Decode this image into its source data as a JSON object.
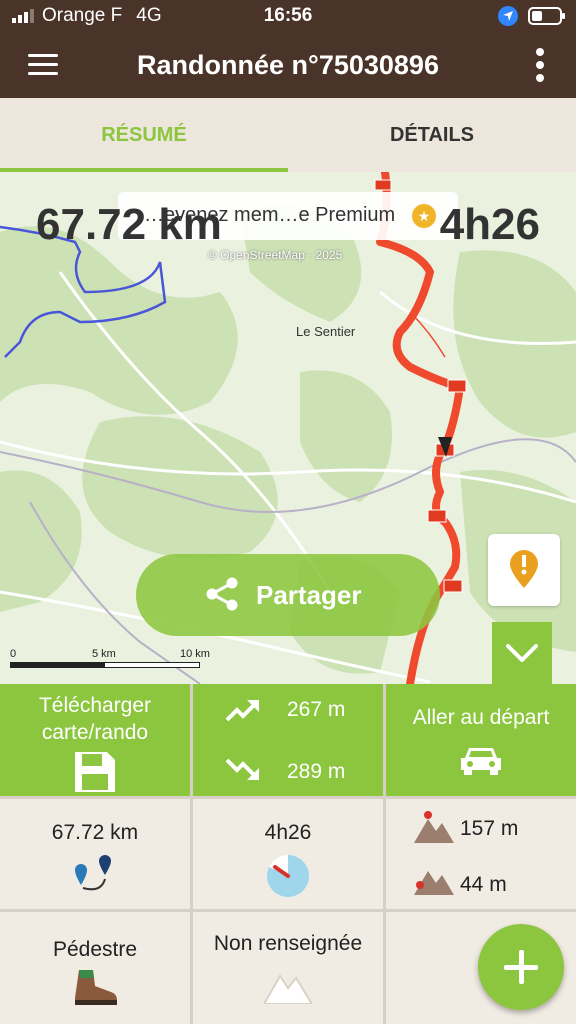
{
  "status_bar": {
    "carrier": "Orange F",
    "network": "4G",
    "time": "16:56"
  },
  "header": {
    "title": "Randonnée n°75030896",
    "menu_icon": "hamburger-icon",
    "more_icon": "more-vertical-icon"
  },
  "tabs": [
    {
      "label": "RÉSUMÉ",
      "active": true
    },
    {
      "label": "DÉTAILS",
      "active": false
    }
  ],
  "map": {
    "banner_text": "…evenez mem…e Premium",
    "distance": "67.72 km",
    "duration": "4h26",
    "attribution": "© OpenStreetMap · 2025",
    "town_label": "Le Sentier",
    "share_label": "Partager",
    "scale_labels": [
      "0",
      "5 km",
      "10 km"
    ],
    "route_color": "#f04a2e",
    "boundary_color": "#4a56d8"
  },
  "actions": {
    "download_label": "Télécharger carte/rando",
    "ascent": "267 m",
    "descent": "289 m",
    "go_start_label": "Aller au départ"
  },
  "stats": {
    "distance": "67.72 km",
    "duration": "4h26",
    "max_altitude": "157 m",
    "min_altitude": "44 m",
    "activity": "Pédestre",
    "difficulty": "Non renseignée"
  },
  "colors": {
    "brand_brown": "#4a3328",
    "accent_green": "#8cc63f"
  }
}
